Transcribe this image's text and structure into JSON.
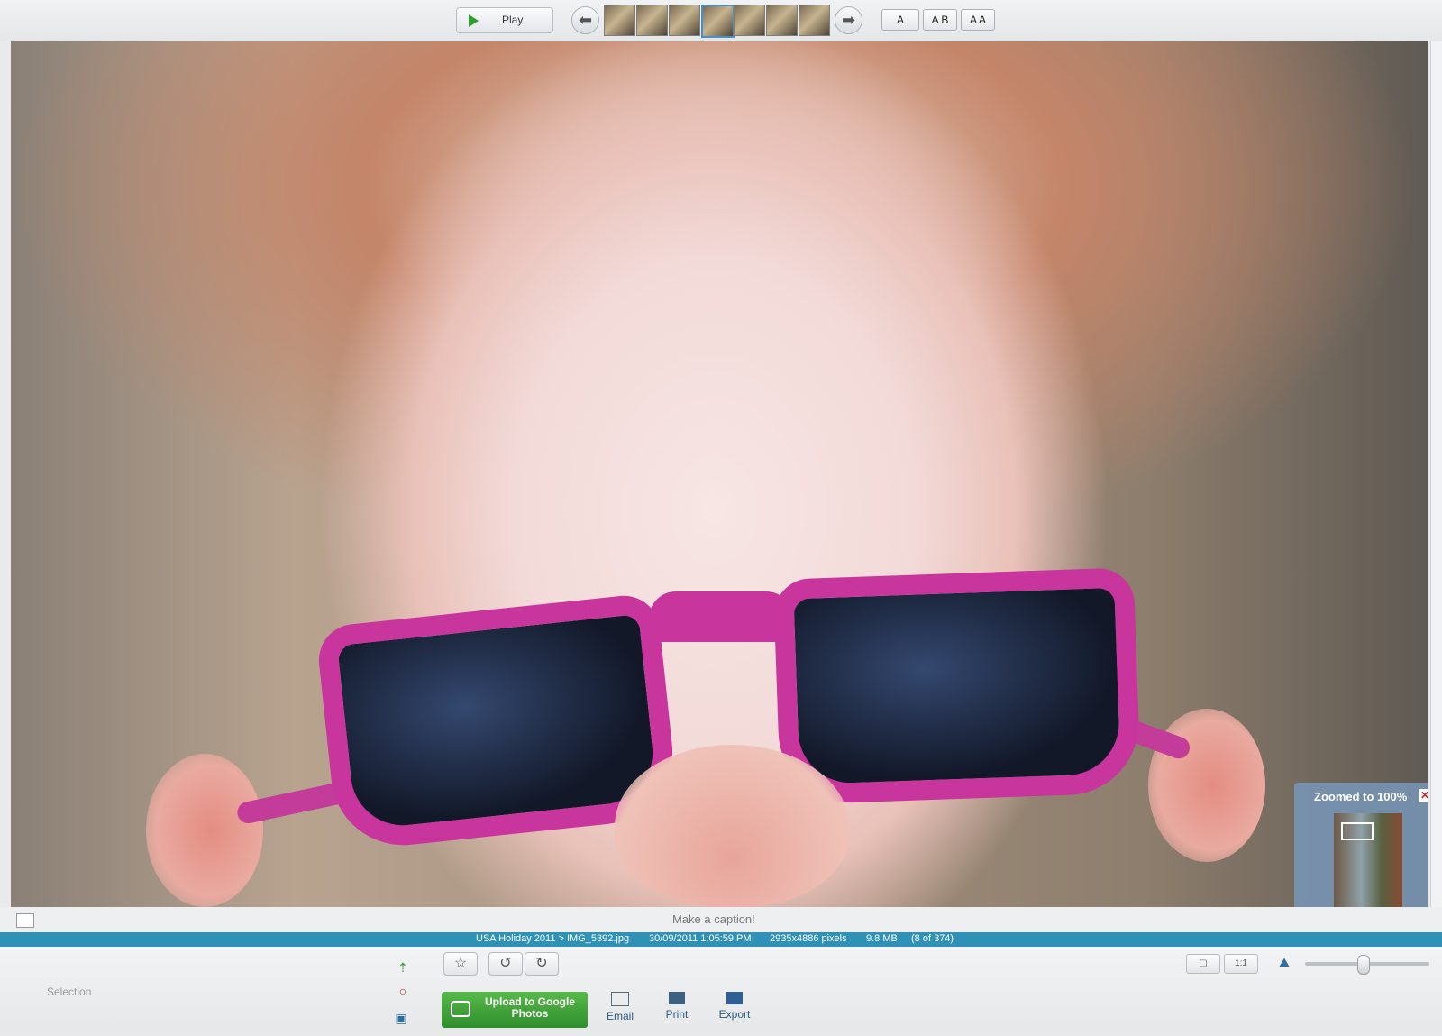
{
  "toolbar": {
    "play_label": "Play",
    "view_buttons": [
      "A",
      "A B",
      "A A"
    ]
  },
  "photo": {
    "zoom_panel_title": "Zoomed to 100%",
    "close_symbol": "✕"
  },
  "caption": {
    "placeholder": "Make a caption!"
  },
  "info": {
    "path": "USA Holiday 2011 > IMG_5392.jpg",
    "datetime": "30/09/2011 1:05:59 PM",
    "dimensions": "2935x4886 pixels",
    "size": "9.8 MB",
    "position": "(8 of 374)"
  },
  "bottom": {
    "selection_label": "Selection",
    "upload_label": "Upload to Google Photos",
    "email_label": "Email",
    "print_label": "Print",
    "export_label": "Export",
    "fit_label": "1:1"
  },
  "colors": {
    "accent": "#2f91b6",
    "upload": "#3a9b35",
    "glasses": "#c7359d"
  }
}
